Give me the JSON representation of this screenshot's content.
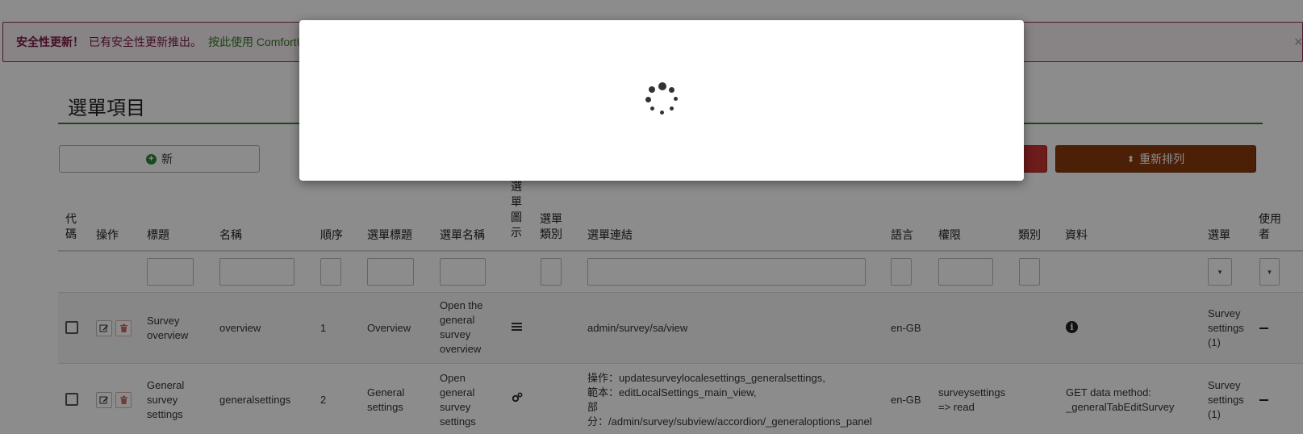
{
  "alert": {
    "strong": "安全性更新！",
    "message": "已有安全性更新推出。",
    "link": "按此使用 ComfortU",
    "close": "×"
  },
  "page": {
    "title": "選單項目"
  },
  "buttons": {
    "new": "新",
    "reorder": "重新排列"
  },
  "table": {
    "headers": {
      "code": "代\n碼",
      "action": "操作",
      "title": "標題",
      "name": "名稱",
      "order": "順序",
      "menu_title": "選單標題",
      "menu_name": "選單名稱",
      "menu_icon": "選\n單\n圖\n示",
      "menu_class": "選單\n類別",
      "menu_link": "選單連結",
      "language": "語言",
      "permission": "權限",
      "category": "類別",
      "data": "資料",
      "menu": "選單",
      "user": "使用\n者"
    },
    "select_caret": "▾",
    "rows": [
      {
        "title": "Survey\noverview",
        "name": "overview",
        "order": "1",
        "menu_title": "Overview",
        "menu_name": "Open the\ngeneral\nsurvey\noverview",
        "icon": "list-icon",
        "menu_link": "admin/survey/sa/view",
        "language": "en-GB",
        "permission": "",
        "data": "",
        "menu": "Survey\nsettings\n(1)"
      },
      {
        "title": "General\nsurvey\nsettings",
        "name": "generalsettings",
        "order": "2",
        "menu_title": "General\nsettings",
        "menu_name": "Open\ngeneral\nsurvey\nsettings",
        "icon": "gears-icon",
        "menu_link": "操作：updatesurveylocalesettings_generalsettings,\n範本：editLocalSettings_main_view,\n部\n分：/admin/survey/subview/accordion/_generaloptions_panel",
        "language": "en-GB",
        "permission": "surveysettings\n=> read",
        "data": "GET data method:\n_generalTabEditSurvey",
        "menu": "Survey\nsettings\n(1)"
      }
    ]
  }
}
